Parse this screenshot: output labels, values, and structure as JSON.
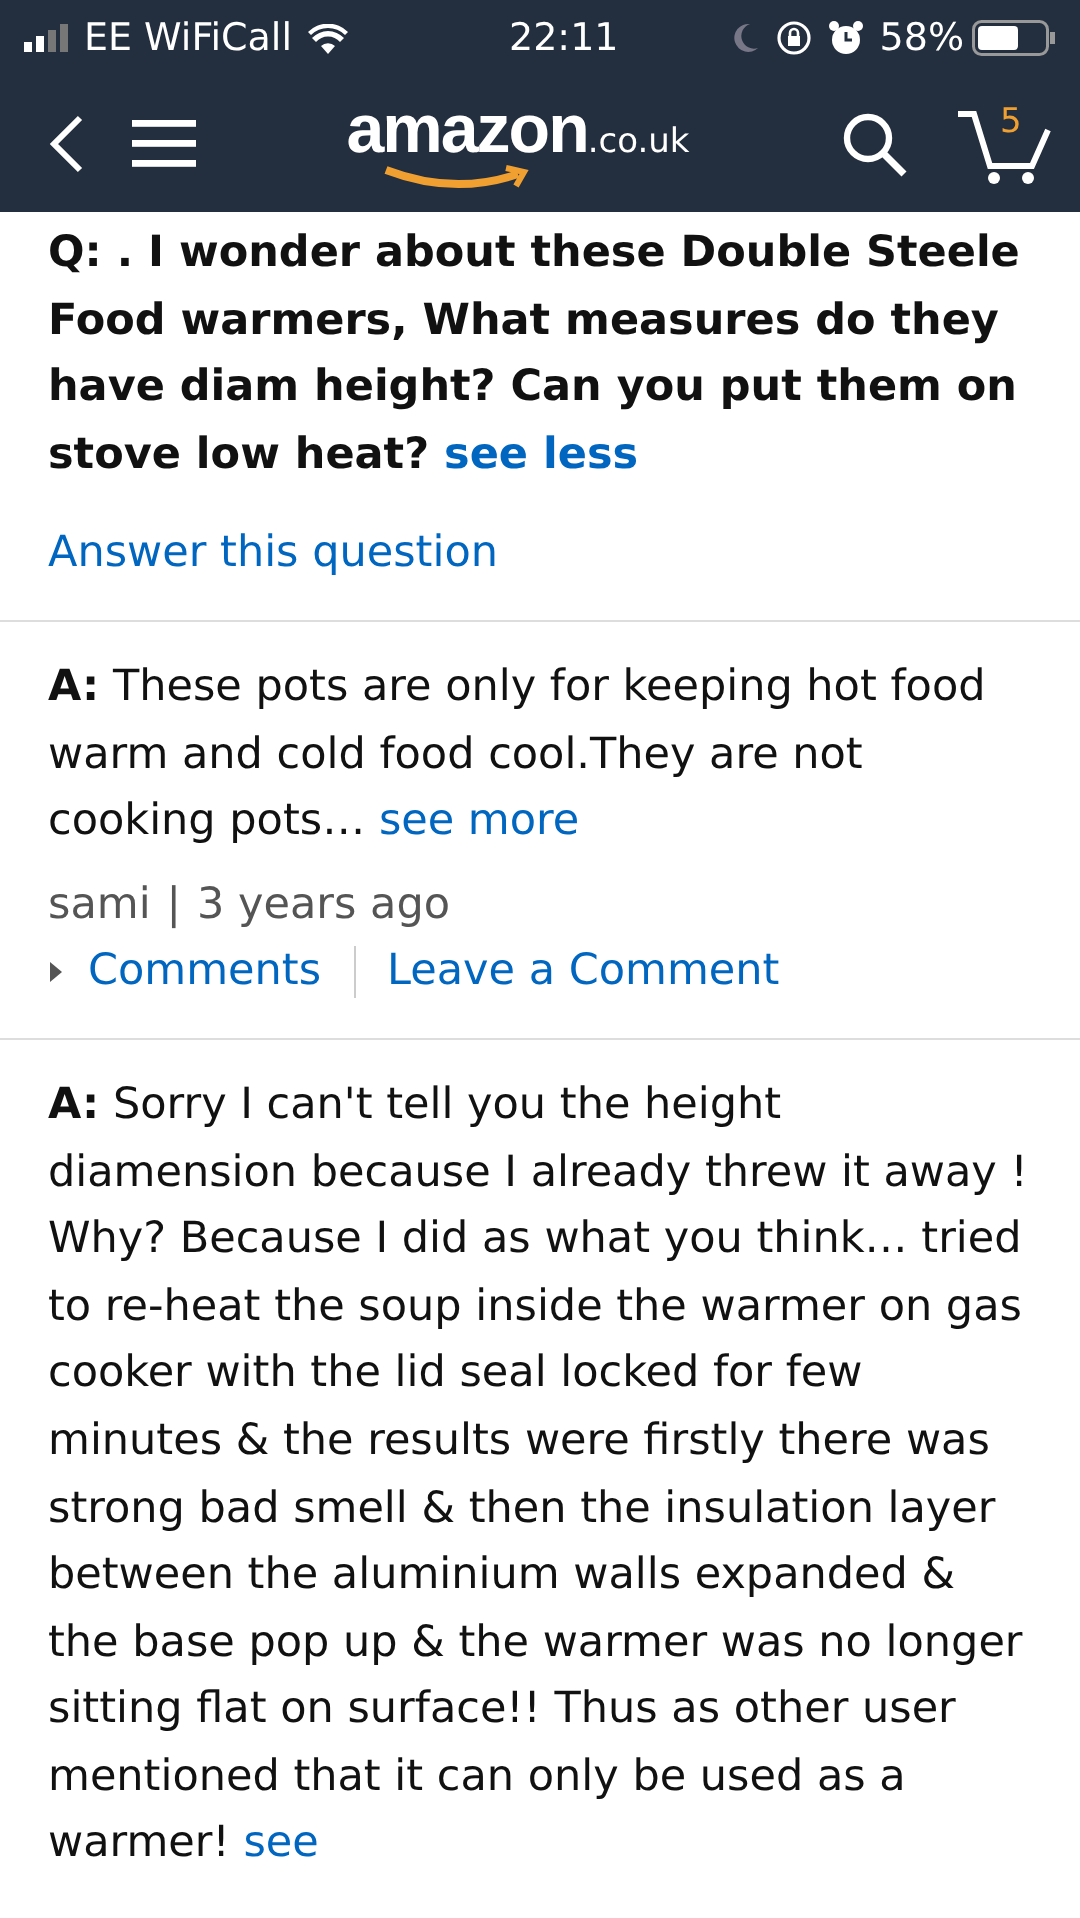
{
  "status_bar": {
    "carrier": "EE WiFiCall",
    "time": "22:11",
    "battery": "58%"
  },
  "nav_bar": {
    "logo": "amazon",
    "logo_suffix": ".co.uk",
    "cart_count": "5"
  },
  "question": {
    "prefix": "Q:",
    "text": ". I wonder about these Double Steele Food warmers, What measures do they have diam height? Can you put them on stove low heat?",
    "toggle": "see less"
  },
  "answer_link": "Answer this question",
  "answers": [
    {
      "prefix": "A:",
      "text": "These pots are only for keeping hot food warm and cold food cool.They are not cooking pots…",
      "toggle": "see more",
      "author": "sami",
      "separator": "|",
      "date": "3 years ago",
      "comments_link": "Comments",
      "leave_comment_link": "Leave a Comment",
      "expanded": false
    },
    {
      "prefix": "A:",
      "text": "Sorry I can't tell you the height diamension because I already threw it away ! Why? Because I did as what you think… tried to re-heat the soup inside the warmer on gas cooker with the lid seal locked for few minutes & the results were firstly there was strong bad smell & then the insulation layer between the aluminium walls expanded & the base pop up & the warmer was no longer sitting flat on surface!! Thus as other user mentioned that it can only be used as a warmer!",
      "toggle": "see"
    }
  ]
}
